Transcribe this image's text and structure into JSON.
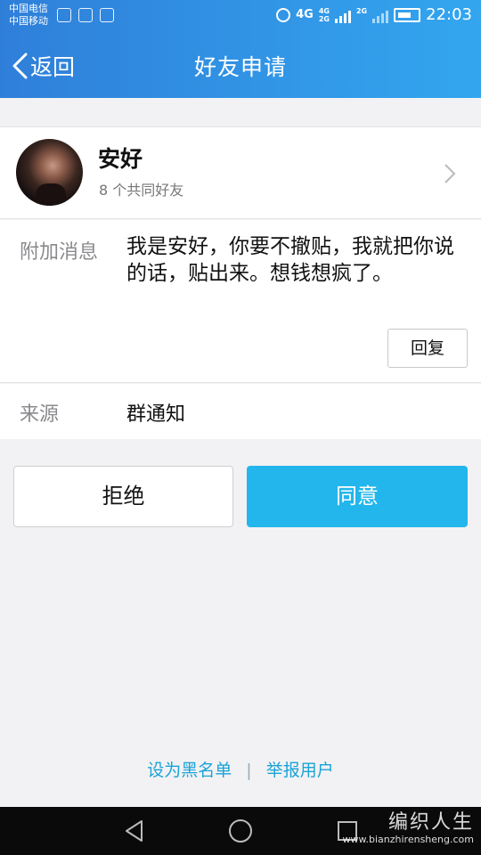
{
  "status_bar": {
    "carrier_1": "中国电信",
    "carrier_2": "中国移动",
    "network": "4G",
    "network_2a": "4G",
    "network_2b": "2G",
    "network_3": "2G",
    "time": "22:03"
  },
  "header": {
    "back_label": "返回",
    "title": "好友申请"
  },
  "profile": {
    "name": "安好",
    "mutual_friends": "8 个共同好友"
  },
  "message": {
    "label": "附加消息",
    "text": "我是安好，你要不撤贴，我就把你说的话，贴出来。想钱想疯了。",
    "reply_label": "回复"
  },
  "source": {
    "label": "来源",
    "value": "群通知"
  },
  "actions": {
    "reject_label": "拒绝",
    "accept_label": "同意"
  },
  "footer": {
    "blacklist_label": "设为黑名单",
    "separator": "|",
    "report_label": "举报用户"
  },
  "watermark": {
    "logo_text": "编织人生",
    "url": "www.bianzhirensheng.com"
  },
  "colors": {
    "header_start": "#2f7fd9",
    "header_end": "#33a6ef",
    "accept": "#23b6ec",
    "link": "#1aa3d6"
  }
}
